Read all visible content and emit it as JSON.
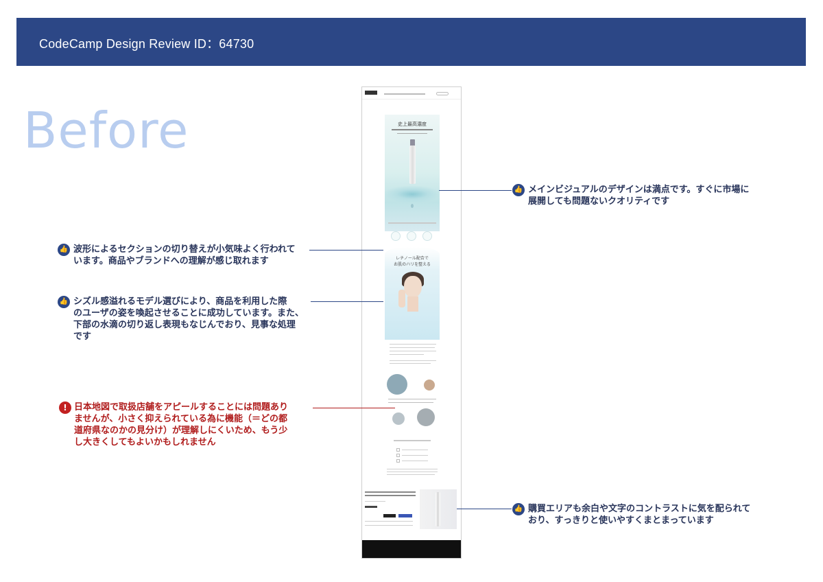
{
  "header": {
    "title": "CodeCamp Design Review ID：64730"
  },
  "heading": {
    "before": "Before"
  },
  "mock": {
    "mv_title": "史上最高濃度",
    "section_title": "レチノール配合で\nお肌のハリを整える"
  },
  "annotations": [
    {
      "type": "good",
      "text": "メインビジュアルのデザインは満点です。すぐに市場に\n展開しても問題ないクオリティです"
    },
    {
      "type": "good",
      "text": "波形によるセクションの切り替えが小気味よく行われて\nいます。商品やブランドへの理解が感じ取れます"
    },
    {
      "type": "good",
      "text": "シズル感溢れるモデル選びにより、商品を利用した際\nのユーザの姿を喚起させることに成功しています。また、\n下部の水滴の切り返し表現もなじんでおり、見事な処理\nです"
    },
    {
      "type": "warn",
      "text": "日本地図で取扱店舗をアピールすることには問題あり\nませんが、小さく抑えられている為に機能（＝どの都\n道府県なのかの見分け）が理解しにくいため、もう少\nし大きくしてもよいかもしれません"
    },
    {
      "type": "good",
      "text": "購買エリアも余白や文字のコントラストに気を配られて\nおり、すっきりと使いやすくまとまっています"
    }
  ],
  "icons": {
    "good": "thumbs-up-icon",
    "warn": "exclamation-icon"
  },
  "colors": {
    "header": "#2c4786",
    "before_text": "#b8cdef",
    "good": "#2c4786",
    "warn": "#c22020"
  }
}
